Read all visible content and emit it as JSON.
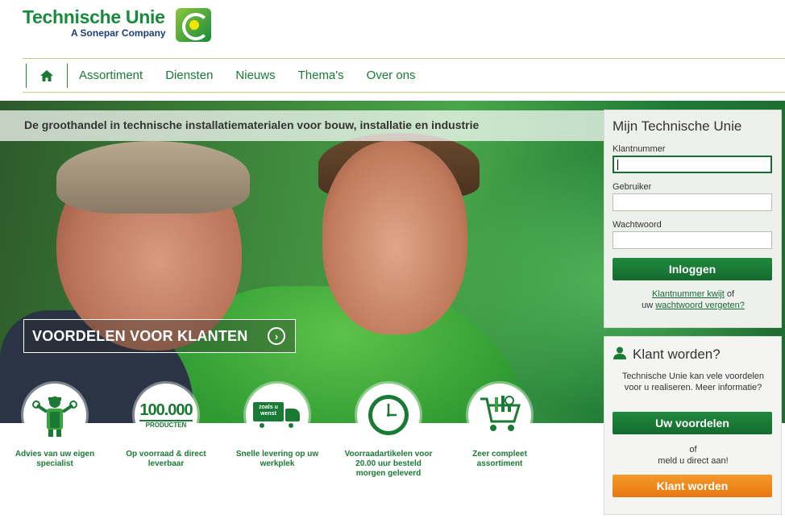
{
  "logo": {
    "title": "Technische Unie",
    "subtitle": "A Sonepar Company"
  },
  "nav": {
    "home_icon": "home-icon",
    "items": [
      "Assortiment",
      "Diensten",
      "Nieuws",
      "Thema's",
      "Over ons"
    ]
  },
  "hero": {
    "banner": "De groothandel in technische installatiematerialen voor bouw, installatie en industrie",
    "cta": "VOORDELEN VOOR KLANTEN"
  },
  "features": [
    {
      "label": "Advies van uw eigen specialist",
      "icon": "specialist-icon"
    },
    {
      "label": "Op voorraad & direct leverbaar",
      "icon": "products-icon",
      "badge": "100.000",
      "badge_sub": "PRODUCTEN"
    },
    {
      "label": "Snelle levering op uw werkplek",
      "icon": "truck-icon",
      "truck_text": "zoals u wenst"
    },
    {
      "label": "Voorraadartikelen voor 20.00 uur besteld morgen geleverd",
      "icon": "clock-icon"
    },
    {
      "label": "Zeer compleet assortiment",
      "icon": "cart-icon"
    }
  ],
  "login": {
    "title": "Mijn Technische Unie",
    "klantnummer_label": "Klantnummer",
    "gebruiker_label": "Gebruiker",
    "wachtwoord_label": "Wachtwoord",
    "klantnummer_value": "",
    "gebruiker_value": "",
    "wachtwoord_value": "",
    "submit": "Inloggen",
    "help_link1": "Klantnummer kwijt",
    "help_mid": "of",
    "help_pre": "uw",
    "help_link2": "wachtwoord vergeten?"
  },
  "signup": {
    "title": "Klant worden?",
    "text": "Technische Unie kan vele voordelen voor u realiseren. Meer informatie?",
    "benefits_button": "Uw voordelen",
    "or": "of",
    "or_sub": "meld u direct aan!",
    "signup_button": "Klant worden"
  },
  "colors": {
    "brand_green": "#1a8a3c",
    "dark_green": "#156a2e",
    "orange": "#f0861c"
  }
}
